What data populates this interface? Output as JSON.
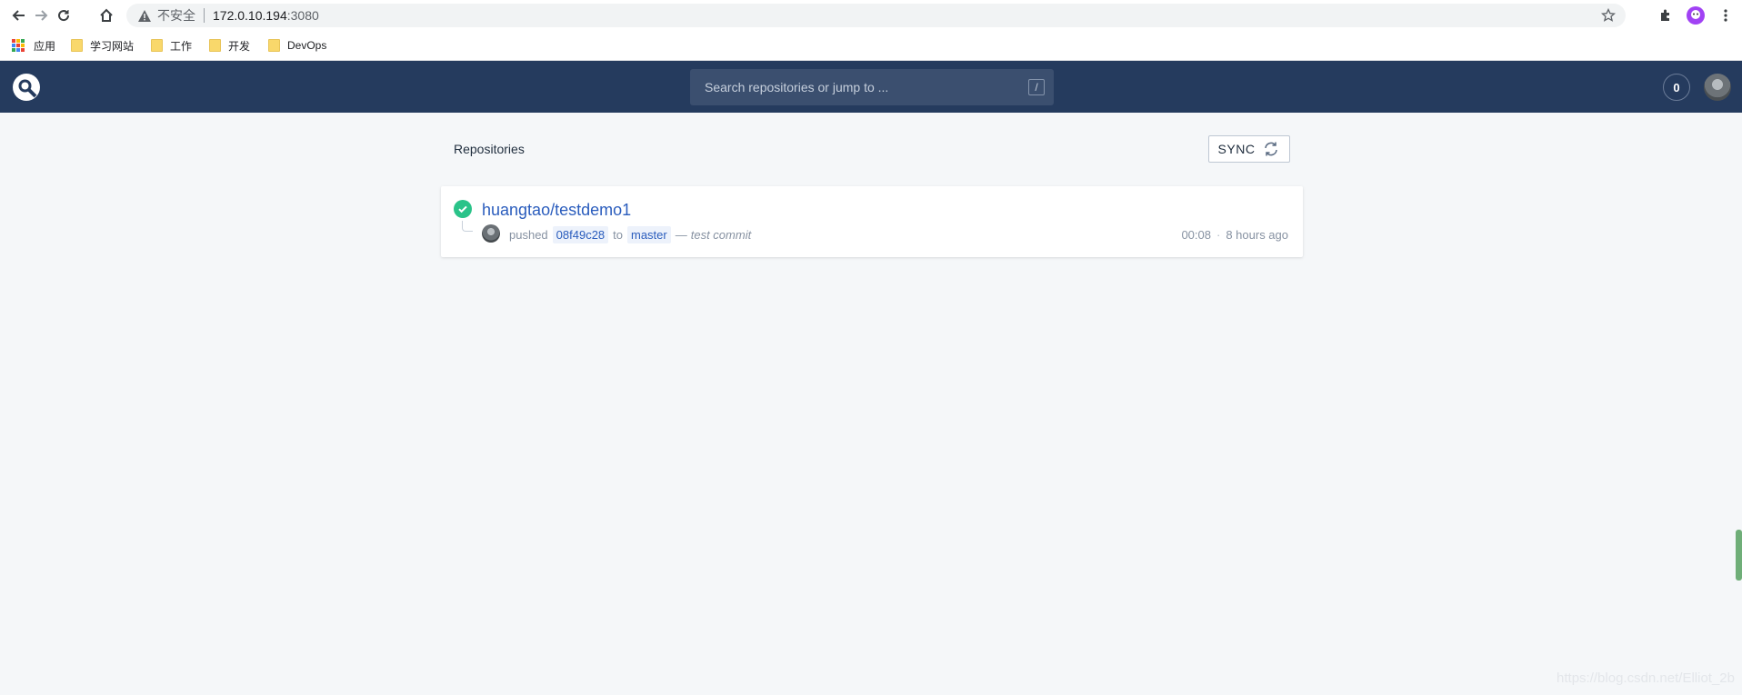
{
  "browser": {
    "insecure_label": "不安全",
    "url_host": "172.0.10.194",
    "url_port": ":3080",
    "bookmarks": {
      "apps": "应用",
      "items": [
        "学习网站",
        "工作",
        "开发",
        "DevOps"
      ]
    },
    "colors": {
      "apps_grid": [
        "#ea4335",
        "#fbbc05",
        "#34a853",
        "#4285f4",
        "#ea4335",
        "#fbbc05",
        "#34a853",
        "#4285f4",
        "#ea4335"
      ]
    }
  },
  "header": {
    "search_placeholder": "Search repositories or jump to ...",
    "search_shortcut": "/",
    "notification_count": "0",
    "colors": {
      "background": "#253b5e"
    }
  },
  "main": {
    "section_title": "Repositories",
    "sync_label": "SYNC",
    "repos": [
      {
        "name": "huangtao/testdemo1",
        "status": "success",
        "action": "pushed",
        "commit": "08f49c28",
        "to": "to",
        "branch": "master",
        "dash": "—",
        "message": "test commit",
        "time": "00:08",
        "relative": "8 hours ago"
      }
    ]
  },
  "watermark": "https://blog.csdn.net/Elliot_2b"
}
